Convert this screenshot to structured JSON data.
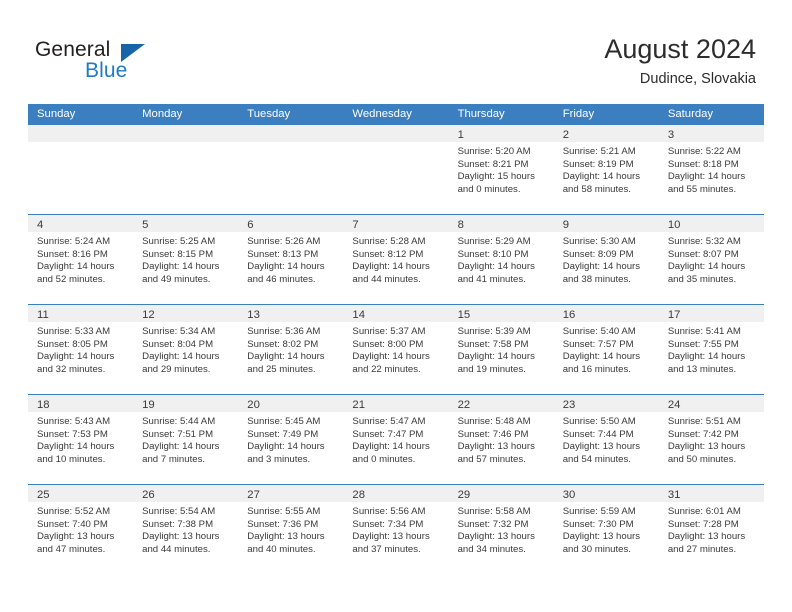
{
  "brand": {
    "name_part1": "General",
    "name_part2": "Blue",
    "triangle_icon": "triangle-icon",
    "colors": {
      "dark": "#231f20",
      "blue": "#1f7ac4",
      "triangle": "#1565a8"
    }
  },
  "header": {
    "title": "August 2024",
    "subtitle": "Dudince, Slovakia"
  },
  "theme": {
    "header_bar": "#3c7fc1",
    "day_band": "#f0f0f0",
    "text": "#3a3a3a",
    "separator": "#3c7fc1"
  },
  "weekdays": [
    {
      "label": "Sunday"
    },
    {
      "label": "Monday"
    },
    {
      "label": "Tuesday"
    },
    {
      "label": "Wednesday"
    },
    {
      "label": "Thursday"
    },
    {
      "label": "Friday"
    },
    {
      "label": "Saturday"
    }
  ],
  "weeks": [
    [
      {
        "day": "",
        "lines": []
      },
      {
        "day": "",
        "lines": []
      },
      {
        "day": "",
        "lines": []
      },
      {
        "day": "",
        "lines": []
      },
      {
        "day": "1",
        "lines": [
          "Sunrise: 5:20 AM",
          "Sunset: 8:21 PM",
          "Daylight: 15 hours",
          "and 0 minutes."
        ]
      },
      {
        "day": "2",
        "lines": [
          "Sunrise: 5:21 AM",
          "Sunset: 8:19 PM",
          "Daylight: 14 hours",
          "and 58 minutes."
        ]
      },
      {
        "day": "3",
        "lines": [
          "Sunrise: 5:22 AM",
          "Sunset: 8:18 PM",
          "Daylight: 14 hours",
          "and 55 minutes."
        ]
      }
    ],
    [
      {
        "day": "4",
        "lines": [
          "Sunrise: 5:24 AM",
          "Sunset: 8:16 PM",
          "Daylight: 14 hours",
          "and 52 minutes."
        ]
      },
      {
        "day": "5",
        "lines": [
          "Sunrise: 5:25 AM",
          "Sunset: 8:15 PM",
          "Daylight: 14 hours",
          "and 49 minutes."
        ]
      },
      {
        "day": "6",
        "lines": [
          "Sunrise: 5:26 AM",
          "Sunset: 8:13 PM",
          "Daylight: 14 hours",
          "and 46 minutes."
        ]
      },
      {
        "day": "7",
        "lines": [
          "Sunrise: 5:28 AM",
          "Sunset: 8:12 PM",
          "Daylight: 14 hours",
          "and 44 minutes."
        ]
      },
      {
        "day": "8",
        "lines": [
          "Sunrise: 5:29 AM",
          "Sunset: 8:10 PM",
          "Daylight: 14 hours",
          "and 41 minutes."
        ]
      },
      {
        "day": "9",
        "lines": [
          "Sunrise: 5:30 AM",
          "Sunset: 8:09 PM",
          "Daylight: 14 hours",
          "and 38 minutes."
        ]
      },
      {
        "day": "10",
        "lines": [
          "Sunrise: 5:32 AM",
          "Sunset: 8:07 PM",
          "Daylight: 14 hours",
          "and 35 minutes."
        ]
      }
    ],
    [
      {
        "day": "11",
        "lines": [
          "Sunrise: 5:33 AM",
          "Sunset: 8:05 PM",
          "Daylight: 14 hours",
          "and 32 minutes."
        ]
      },
      {
        "day": "12",
        "lines": [
          "Sunrise: 5:34 AM",
          "Sunset: 8:04 PM",
          "Daylight: 14 hours",
          "and 29 minutes."
        ]
      },
      {
        "day": "13",
        "lines": [
          "Sunrise: 5:36 AM",
          "Sunset: 8:02 PM",
          "Daylight: 14 hours",
          "and 25 minutes."
        ]
      },
      {
        "day": "14",
        "lines": [
          "Sunrise: 5:37 AM",
          "Sunset: 8:00 PM",
          "Daylight: 14 hours",
          "and 22 minutes."
        ]
      },
      {
        "day": "15",
        "lines": [
          "Sunrise: 5:39 AM",
          "Sunset: 7:58 PM",
          "Daylight: 14 hours",
          "and 19 minutes."
        ]
      },
      {
        "day": "16",
        "lines": [
          "Sunrise: 5:40 AM",
          "Sunset: 7:57 PM",
          "Daylight: 14 hours",
          "and 16 minutes."
        ]
      },
      {
        "day": "17",
        "lines": [
          "Sunrise: 5:41 AM",
          "Sunset: 7:55 PM",
          "Daylight: 14 hours",
          "and 13 minutes."
        ]
      }
    ],
    [
      {
        "day": "18",
        "lines": [
          "Sunrise: 5:43 AM",
          "Sunset: 7:53 PM",
          "Daylight: 14 hours",
          "and 10 minutes."
        ]
      },
      {
        "day": "19",
        "lines": [
          "Sunrise: 5:44 AM",
          "Sunset: 7:51 PM",
          "Daylight: 14 hours",
          "and 7 minutes."
        ]
      },
      {
        "day": "20",
        "lines": [
          "Sunrise: 5:45 AM",
          "Sunset: 7:49 PM",
          "Daylight: 14 hours",
          "and 3 minutes."
        ]
      },
      {
        "day": "21",
        "lines": [
          "Sunrise: 5:47 AM",
          "Sunset: 7:47 PM",
          "Daylight: 14 hours",
          "and 0 minutes."
        ]
      },
      {
        "day": "22",
        "lines": [
          "Sunrise: 5:48 AM",
          "Sunset: 7:46 PM",
          "Daylight: 13 hours",
          "and 57 minutes."
        ]
      },
      {
        "day": "23",
        "lines": [
          "Sunrise: 5:50 AM",
          "Sunset: 7:44 PM",
          "Daylight: 13 hours",
          "and 54 minutes."
        ]
      },
      {
        "day": "24",
        "lines": [
          "Sunrise: 5:51 AM",
          "Sunset: 7:42 PM",
          "Daylight: 13 hours",
          "and 50 minutes."
        ]
      }
    ],
    [
      {
        "day": "25",
        "lines": [
          "Sunrise: 5:52 AM",
          "Sunset: 7:40 PM",
          "Daylight: 13 hours",
          "and 47 minutes."
        ]
      },
      {
        "day": "26",
        "lines": [
          "Sunrise: 5:54 AM",
          "Sunset: 7:38 PM",
          "Daylight: 13 hours",
          "and 44 minutes."
        ]
      },
      {
        "day": "27",
        "lines": [
          "Sunrise: 5:55 AM",
          "Sunset: 7:36 PM",
          "Daylight: 13 hours",
          "and 40 minutes."
        ]
      },
      {
        "day": "28",
        "lines": [
          "Sunrise: 5:56 AM",
          "Sunset: 7:34 PM",
          "Daylight: 13 hours",
          "and 37 minutes."
        ]
      },
      {
        "day": "29",
        "lines": [
          "Sunrise: 5:58 AM",
          "Sunset: 7:32 PM",
          "Daylight: 13 hours",
          "and 34 minutes."
        ]
      },
      {
        "day": "30",
        "lines": [
          "Sunrise: 5:59 AM",
          "Sunset: 7:30 PM",
          "Daylight: 13 hours",
          "and 30 minutes."
        ]
      },
      {
        "day": "31",
        "lines": [
          "Sunrise: 6:01 AM",
          "Sunset: 7:28 PM",
          "Daylight: 13 hours",
          "and 27 minutes."
        ]
      }
    ]
  ]
}
